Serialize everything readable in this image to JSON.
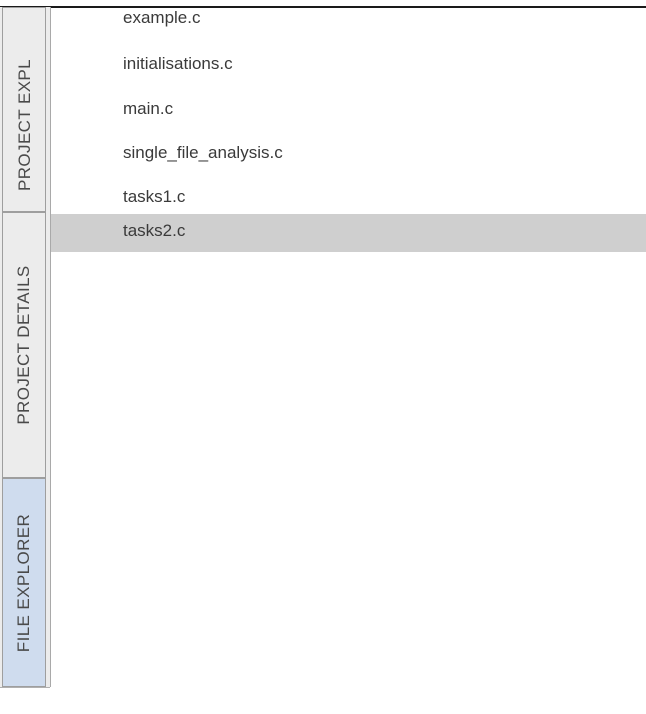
{
  "tabs": [
    {
      "label": "PROJECT EXPL",
      "active": false
    },
    {
      "label": "PROJECT DETAILS",
      "active": false
    },
    {
      "label": "FILE EXPLORER",
      "active": true
    }
  ],
  "files": [
    {
      "name": "example.c",
      "selected": false
    },
    {
      "name": "initialisations.c",
      "selected": false
    },
    {
      "name": "main.c",
      "selected": false
    },
    {
      "name": "single_file_analysis.c",
      "selected": false
    },
    {
      "name": "tasks1.c",
      "selected": false
    },
    {
      "name": "tasks2.c",
      "selected": true
    }
  ],
  "colors": {
    "selected_row": "#cfcfcf",
    "active_tab": "#cfdcee",
    "text": "#3a3a3a"
  }
}
